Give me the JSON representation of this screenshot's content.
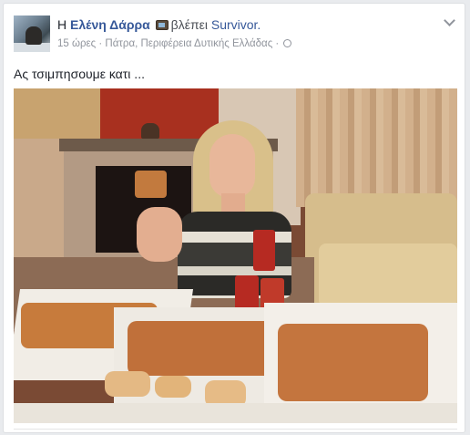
{
  "post": {
    "author_prefix": "Η",
    "author": "Ελένη Δάρρα",
    "activity": "βλέπει",
    "show": "Survivor.",
    "time": "15 ώρες",
    "separator": " · ",
    "location": "Πάτρα, Περιφέρεια Δυτικής Ελλάδας",
    "audience_icon": "globe-icon",
    "status_text": "Ας τσιμπησουμε κατι ...",
    "feeling_icon": "tv-icon",
    "menu_icon": "chevron-down-icon"
  },
  "colors": {
    "link": "#365899",
    "meta": "#90949c",
    "text": "#1d2129",
    "background": "#e9ebee"
  }
}
